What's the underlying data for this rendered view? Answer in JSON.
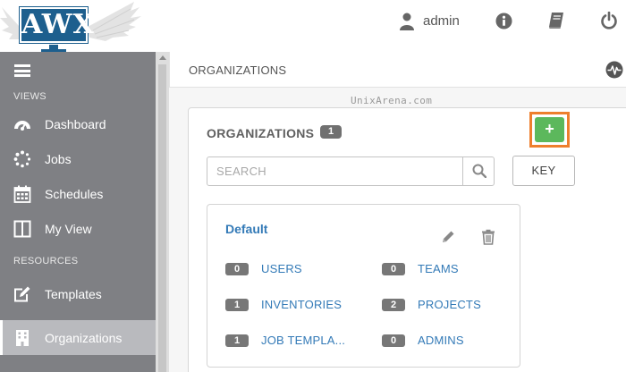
{
  "header": {
    "logo_text": "AWX",
    "user_name": "admin",
    "icons": [
      "user-icon",
      "info-icon",
      "book-icon",
      "power-icon"
    ]
  },
  "sidebar": {
    "sections": {
      "views": "VIEWS",
      "resources": "RESOURCES"
    },
    "items": [
      {
        "label": "Dashboard",
        "icon": "dashboard-icon"
      },
      {
        "label": "Jobs",
        "icon": "jobs-icon"
      },
      {
        "label": "Schedules",
        "icon": "calendar-icon"
      },
      {
        "label": "My View",
        "icon": "my-view-icon"
      },
      {
        "label": "Templates",
        "icon": "templates-icon"
      },
      {
        "label": "Organizations",
        "icon": "building-icon",
        "active": true
      }
    ]
  },
  "main": {
    "breadcrumb": "ORGANIZATIONS",
    "watermark": "UnixArena.com",
    "panel_title": "ORGANIZATIONS",
    "count": "1",
    "add_label": "+",
    "search_placeholder": "SEARCH",
    "key_label": "KEY",
    "organization": {
      "name": "Default",
      "stats": [
        {
          "count": "0",
          "label": "USERS"
        },
        {
          "count": "0",
          "label": "TEAMS"
        },
        {
          "count": "1",
          "label": "INVENTORIES"
        },
        {
          "count": "2",
          "label": "PROJECTS"
        },
        {
          "count": "1",
          "label": "JOB TEMPLA..."
        },
        {
          "count": "0",
          "label": "ADMINS"
        }
      ]
    }
  },
  "colors": {
    "brand_blue": "#1d5f8e",
    "link_blue": "#337ab7",
    "sidebar_bg": "#7f8084",
    "add_green": "#5cb85c",
    "highlight_orange": "#ee7f2d"
  }
}
